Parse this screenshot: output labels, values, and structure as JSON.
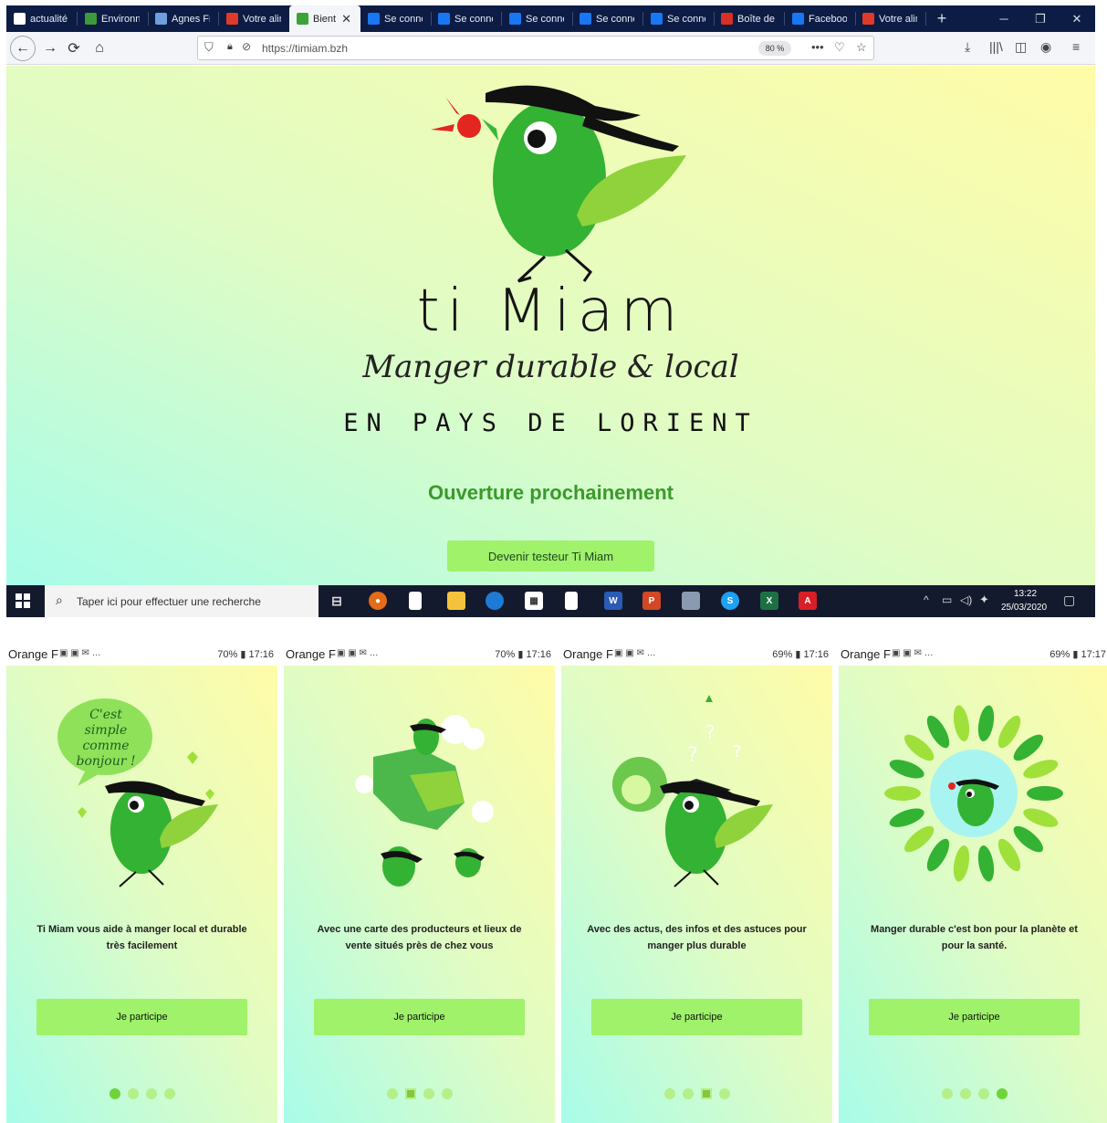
{
  "browser": {
    "tabs": [
      {
        "label": "actualité",
        "icon": "google-icon",
        "color": "#ffffff"
      },
      {
        "label": "Environn",
        "icon": "environment-icon",
        "color": "#3c9a3c"
      },
      {
        "label": "Agnes Fr",
        "icon": "cap-icon",
        "color": "#6ea0e0"
      },
      {
        "label": "Votre alim",
        "icon": "z-icon",
        "color": "#e03a2a"
      },
      {
        "label": "Bient",
        "icon": "bird-icon",
        "color": "#3aa33a"
      },
      {
        "label": "Se conne",
        "icon": "facebook-icon",
        "color": "#1877f2"
      },
      {
        "label": "Se conne",
        "icon": "facebook-icon",
        "color": "#1877f2"
      },
      {
        "label": "Se conne",
        "icon": "facebook-icon",
        "color": "#1877f2"
      },
      {
        "label": "Se conne",
        "icon": "facebook-icon",
        "color": "#1877f2"
      },
      {
        "label": "Se conne",
        "icon": "facebook-icon",
        "color": "#1877f2"
      },
      {
        "label": "Boîte de",
        "icon": "gmail-icon",
        "color": "#d93025"
      },
      {
        "label": "Faceboo",
        "icon": "facebook-icon",
        "color": "#1877f2"
      },
      {
        "label": "Votre alim",
        "icon": "z-icon",
        "color": "#e03a2a"
      }
    ],
    "url": "https://timiam.bzh",
    "zoom": "80 %"
  },
  "page": {
    "title": "ti Miam",
    "tagline": "Manger durable & local",
    "region": "EN PAYS DE LORIENT",
    "announcement": "Ouverture prochainement",
    "cta": "Devenir testeur Ti Miam"
  },
  "taskbar": {
    "search_placeholder": "Taper ici pour effectuer une recherche",
    "time": "13:22",
    "date": "25/03/2020"
  },
  "phones": [
    {
      "carrier": "Orange F",
      "status": "70% ▮ 17:16",
      "bubble": "C'est simple comme bonjour !",
      "caption": "Ti Miam vous aide à manger local et durable très facilement",
      "button": "Je participe",
      "active_dot": 0
    },
    {
      "carrier": "Orange F",
      "status": "70% ▮ 17:16",
      "caption": "Avec une carte des producteurs et lieux de vente situés près de chez vous",
      "button": "Je participe",
      "active_dot": 1
    },
    {
      "carrier": "Orange F",
      "status": "69% ▮ 17:16",
      "caption": "Avec des actus, des infos et des astuces pour manger plus durable",
      "button": "Je participe",
      "active_dot": 2
    },
    {
      "carrier": "Orange F",
      "status": "69% ▮ 17:17",
      "caption": "Manger durable c'est bon pour la planète et pour la santé.",
      "button": "Je participe",
      "active_dot": 3
    }
  ],
  "colors": {
    "accent_green": "#9ff26a",
    "title_green": "#3a9a2a",
    "bird_green": "#33b233"
  }
}
